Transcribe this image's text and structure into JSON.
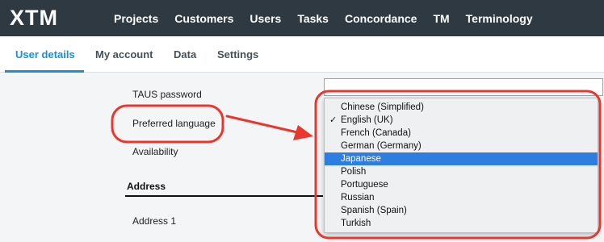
{
  "topbar": {
    "logo_text": "XTM",
    "nav": [
      "Projects",
      "Customers",
      "Users",
      "Tasks",
      "Concordance",
      "TM",
      "Terminology"
    ]
  },
  "tabs": [
    "User details",
    "My account",
    "Data",
    "Settings"
  ],
  "form": {
    "taus_password_label": "TAUS password",
    "preferred_language_label": "Preferred language",
    "availability_label": "Availability",
    "address_heading": "Address",
    "address1_label": "Address 1"
  },
  "language_dropdown": {
    "options": [
      "Chinese (Simplified)",
      "English (UK)",
      "French (Canada)",
      "German (Germany)",
      "Japanese",
      "Polish",
      "Portuguese",
      "Russian",
      "Spanish (Spain)",
      "Turkish"
    ],
    "checked": "English (UK)",
    "highlighted": "Japanese",
    "check_mark": "✓"
  },
  "colors": {
    "topbar": "#2e3942",
    "accent": "#1a8fd8",
    "annotation": "#e8382e",
    "highlight": "#2e7de1"
  }
}
